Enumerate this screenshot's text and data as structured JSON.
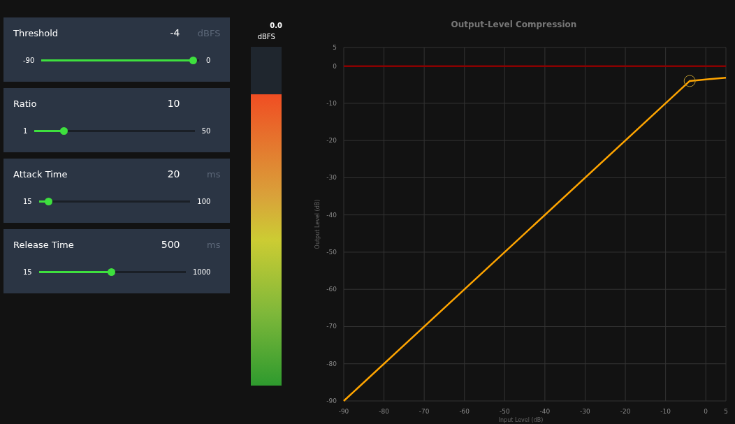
{
  "controls": [
    {
      "label": "Threshold",
      "value": "-4",
      "unit": "dBFS",
      "min": "-90",
      "max": "0",
      "level": 0.96
    },
    {
      "label": "Ratio",
      "value": "10",
      "min": "1",
      "max": "50",
      "level": 0.18
    },
    {
      "label": "Attack Time",
      "value": "20",
      "unit": "ms",
      "min": "15",
      "max": "100",
      "level": 0.06
    },
    {
      "label": "Release Time",
      "value": "500",
      "unit": "ms",
      "min": "15",
      "max": "1000",
      "level": 0.49
    }
  ],
  "meter": {
    "reading": "0.0",
    "unit": "dBFS",
    "level": 0.86
  },
  "chart": {
    "chart_data": {
      "type": "line",
      "title": "Output-Level Compression",
      "xlabel": "Input Level (dB)",
      "ylabel": "Output Level (dB)",
      "xlim": [
        -90,
        5
      ],
      "ylim": [
        -90,
        5
      ],
      "xticks": [
        -90,
        -80,
        -70,
        -60,
        -50,
        -40,
        -30,
        -20,
        -10,
        0,
        5
      ],
      "yticks": [
        -90,
        -80,
        -70,
        -60,
        -50,
        -40,
        -30,
        -20,
        -10,
        0,
        5
      ],
      "x": [
        -90,
        -4,
        5
      ],
      "series": [
        {
          "color": "#ffa500",
          "values": [
            -90,
            -4,
            -3.1
          ]
        }
      ],
      "grid": true,
      "ref_lines": [
        {
          "axis": "y",
          "value": 0,
          "color": "#8b0000"
        }
      ]
    }
  }
}
